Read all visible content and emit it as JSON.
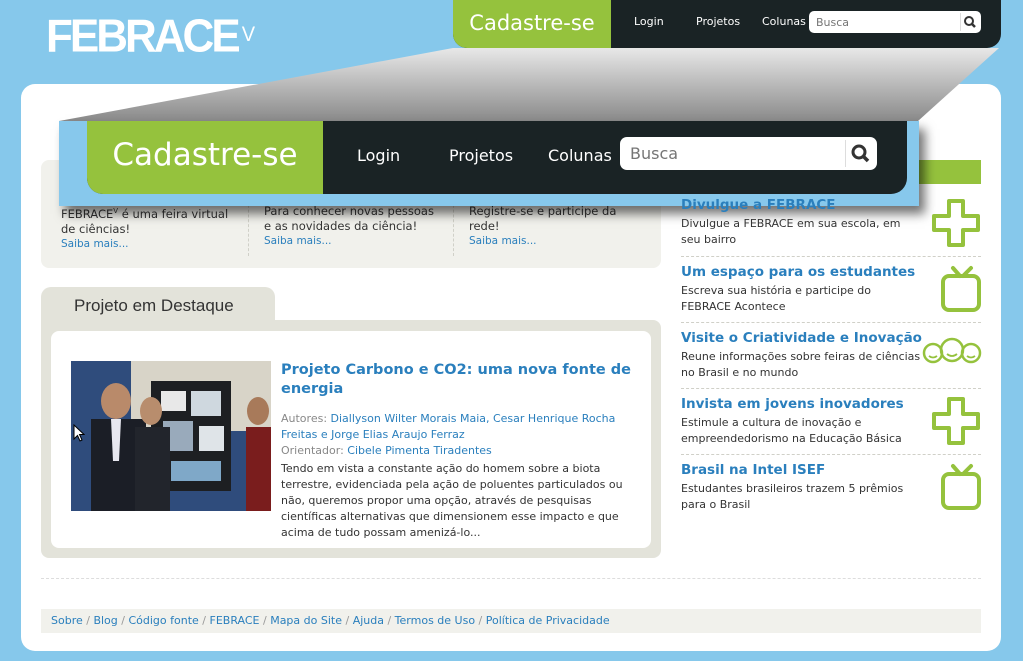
{
  "logo": {
    "text": "FEBRACE",
    "sup": "V"
  },
  "topbar": {
    "signup": "Cadastre-se",
    "nav": [
      "Login",
      "Projetos",
      "Colunas"
    ],
    "search_placeholder": "Busca"
  },
  "features": [
    {
      "text1": "FEBRACE",
      "sup": "V",
      "text2": " é uma feira virtual",
      "text3": "de ciências!",
      "more": "Saiba mais..."
    },
    {
      "text1": "Para conhecer novas pessoas",
      "text3": "e as novidades da ciência!",
      "more": "Saiba mais..."
    },
    {
      "text1": "Registre-se e participe da",
      "text3": "rede!",
      "more": "Saiba mais..."
    }
  ],
  "featured": {
    "tab": "Projeto em Destaque",
    "title": "Projeto Carbono e CO2: uma nova fonte de energia",
    "authors_label": "Autores:",
    "authors": "Diallyson Wilter Morais Maia, Cesar Henrique Rocha Freitas e Jorge Elias Araujo Ferraz",
    "advisor_label": "Orientador:",
    "advisor": "Cibele Pimenta Tiradentes",
    "description": "Tendo em vista a constante ação do homem sobre a biota terrestre, evidenciada pela ação de poluentes particulados ou não, queremos propor uma opção, através de pesquisas científicas alternativas que dimensionem esse impacto e que acima de tudo possam amenizá-lo..."
  },
  "sidebar": [
    {
      "title": "Divulgue a FEBRACE",
      "desc": "Divulgue a FEBRACE em sua escola, em seu bairro",
      "icon": "plus-icon"
    },
    {
      "title": "Um espaço para os estudantes",
      "desc": "Escreva sua história e participe do FEBRACE Acontece",
      "icon": "tv-icon"
    },
    {
      "title": "Visite o Criatividade e Inovação",
      "desc": "Reune informações sobre feiras de ciências no Brasil e no mundo",
      "icon": "people-icon"
    },
    {
      "title": "Invista em jovens inovadores",
      "desc": "Estimule a cultura de inovação e empreendedorismo na Educação Básica",
      "icon": "plus-icon"
    },
    {
      "title": "Brasil na Intel ISEF",
      "desc": "Estudantes brasileiros trazem 5 prêmios para o Brasil",
      "icon": "tv-icon"
    }
  ],
  "footer": [
    "Sobre",
    "Blog",
    "Código fonte",
    "FEBRACE",
    "Mapa do Site",
    "Ajuda",
    "Termos de Uso",
    "Política de Privacidade"
  ],
  "colors": {
    "green": "#95c23d",
    "dark": "#1a2325",
    "link": "#2a7fbd",
    "sky": "#86c8eb"
  }
}
